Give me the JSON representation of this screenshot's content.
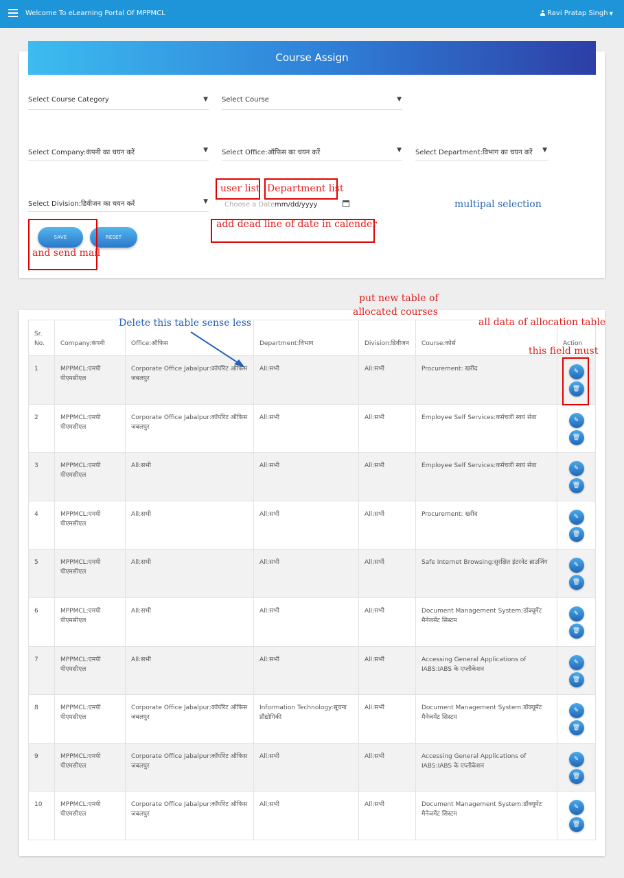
{
  "topbar": {
    "title": "Welcome To eLearning Portal Of MPPMCL",
    "user_name": "Ravi Pratap Singh",
    "menu_icon": "hamburger-icon",
    "user_icon": "user-icon"
  },
  "form": {
    "heading": "Course Assign",
    "course_category": "Select Course Category",
    "course": "Select Course",
    "company": "Select Company:कंपनी का चयन करें",
    "office": "Select Office:ऑफिस का चयन करें",
    "department": "Select Department:विभाग का चयन करें",
    "division": "Select Division:डिवीजन का चयन करें",
    "date_placeholder": "Choose a Date",
    "date_value": "mm/dd/yyyy",
    "save_label": "SAVE",
    "reset_label": "RESET",
    "accent_color": "#1e95d8"
  },
  "annotations": {
    "user_list": "user list",
    "department_list": "Department list",
    "multiple_selection": "multipal selection",
    "deadline": "add dead line of date in calender",
    "send_mail": "and send mail",
    "put_new_table_1": "put new table of",
    "put_new_table_2": "allocated courses",
    "delete_table": "Delete this table sense less",
    "all_data": "all data of allocation table",
    "field_must": "this field must",
    "red_color": "#e21d1d",
    "blue_color": "#2563b8"
  },
  "table": {
    "headers": {
      "sr_1": "Sr.",
      "sr_2": "No.",
      "company": "Company:कंपनी",
      "office": "Office:ऑफिस",
      "department": "Department:विभाग",
      "division": "Division:डिवीजन",
      "course": "Course:कोर्स",
      "action": "Action"
    },
    "rows": [
      {
        "sr": "1",
        "company": "MPPMCL:एमपी पीएमसीएल",
        "office": "Corporate Office Jabalpur:कॉर्पोरेट ऑफिस जबलपुर",
        "department": "All:सभी",
        "division": "All:सभी",
        "course": "Procurement: खरीद"
      },
      {
        "sr": "2",
        "company": "MPPMCL:एमपी पीएमसीएल",
        "office": "Corporate Office Jabalpur:कॉर्पोरेट ऑफिस जबलपुर",
        "department": "All:सभी",
        "division": "All:सभी",
        "course": "Employee Self Services:कर्मचारी स्वयं सेवा"
      },
      {
        "sr": "3",
        "company": "MPPMCL:एमपी पीएमसीएल",
        "office": "All:सभी",
        "department": "All:सभी",
        "division": "All:सभी",
        "course": "Employee Self Services:कर्मचारी स्वयं सेवा"
      },
      {
        "sr": "4",
        "company": "MPPMCL:एमपी पीएमसीएल",
        "office": "All:सभी",
        "department": "All:सभी",
        "division": "All:सभी",
        "course": "Procurement: खरीद"
      },
      {
        "sr": "5",
        "company": "MPPMCL:एमपी पीएमसीएल",
        "office": "All:सभी",
        "department": "All:सभी",
        "division": "All:सभी",
        "course": "Safe Internet Browsing:सुरक्षित इंटरनेट ब्राउजिंग"
      },
      {
        "sr": "6",
        "company": "MPPMCL:एमपी पीएमसीएल",
        "office": "All:सभी",
        "department": "All:सभी",
        "division": "All:सभी",
        "course": "Document Management System:डॉक्यूमेंट मैनेजमेंट सिस्टम"
      },
      {
        "sr": "7",
        "company": "MPPMCL:एमपी पीएमसीएल",
        "office": "All:सभी",
        "department": "All:सभी",
        "division": "All:सभी",
        "course": "Accessing General Applications of IABS:IABS के एप्लीकेशन"
      },
      {
        "sr": "8",
        "company": "MPPMCL:एमपी पीएमसीएल",
        "office": "Corporate Office Jabalpur:कॉर्पोरेट ऑफिस जबलपुर",
        "department": "Information Technology:सूचना प्रौद्योगिकी",
        "division": "All:सभी",
        "course": "Document Management System:डॉक्यूमेंट मैनेजमेंट सिस्टम"
      },
      {
        "sr": "9",
        "company": "MPPMCL:एमपी पीएमसीएल",
        "office": "Corporate Office Jabalpur:कॉर्पोरेट ऑफिस जबलपुर",
        "department": "All:सभी",
        "division": "All:सभी",
        "course": "Accessing General Applications of IABS:IABS के एप्लीकेशन"
      },
      {
        "sr": "10",
        "company": "MPPMCL:एमपी पीएमसीएल",
        "office": "Corporate Office Jabalpur:कॉर्पोरेट ऑफिस जबलपुर",
        "department": "All:सभी",
        "division": "All:सभी",
        "course": "Document Management System:डॉक्यूमेंट मैनेजमेंट सिस्टम"
      }
    ],
    "edit_icon": "edit-icon",
    "delete_icon": "trash-icon"
  }
}
